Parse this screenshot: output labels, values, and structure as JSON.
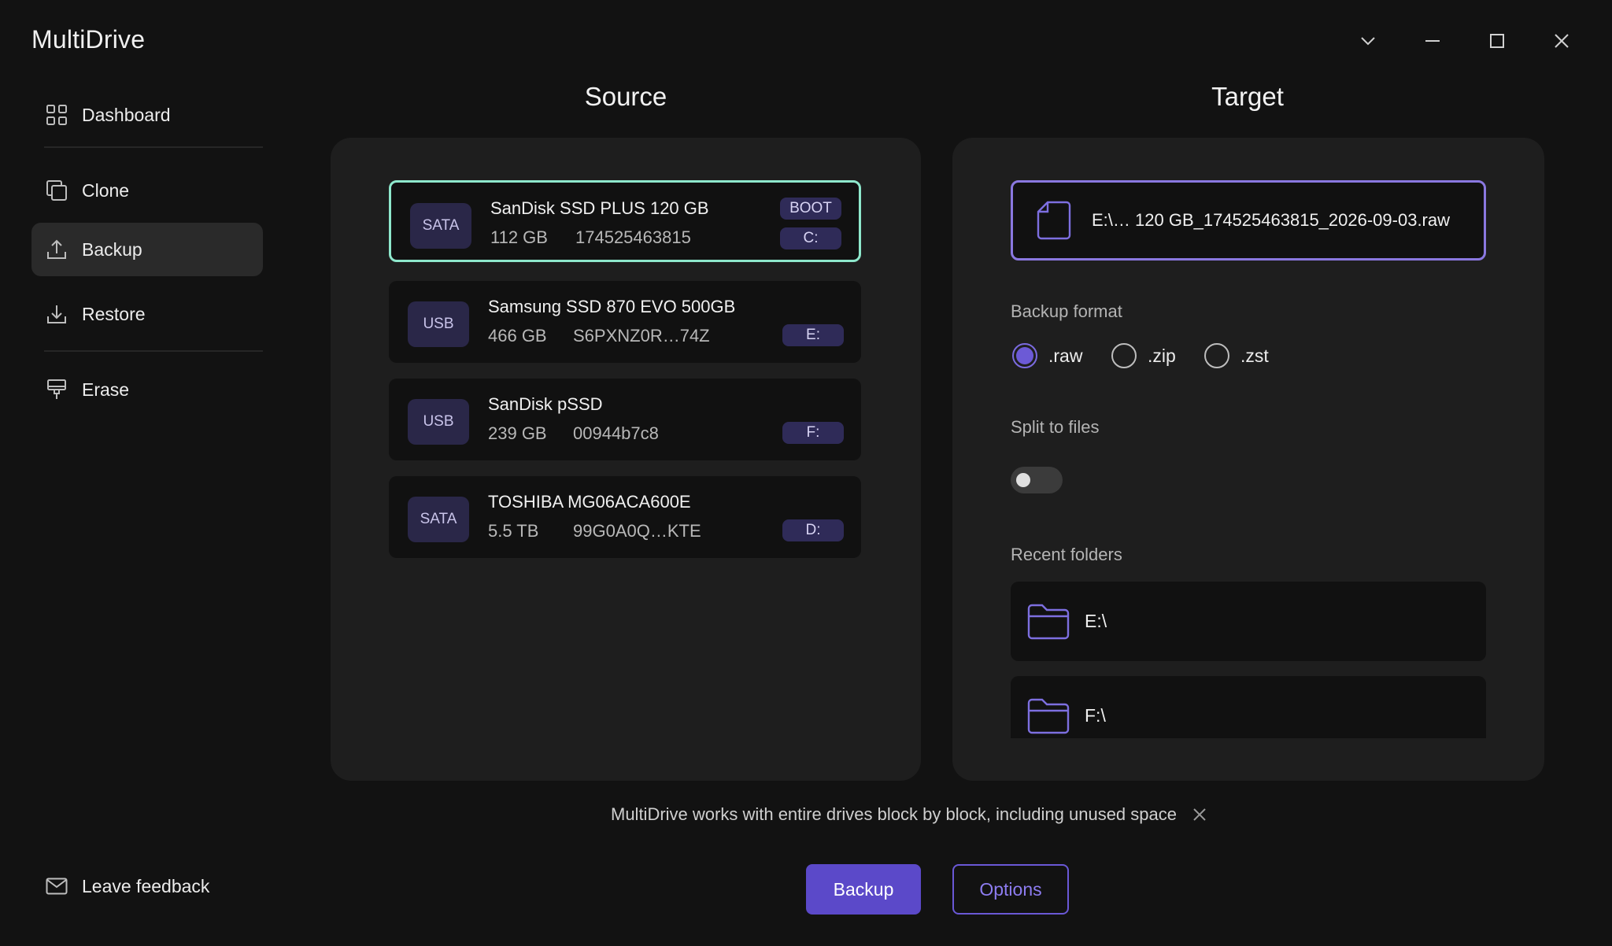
{
  "app": {
    "title": "MultiDrive"
  },
  "window_controls": [
    "chevron-down-icon",
    "minimize-icon",
    "maximize-icon",
    "close-icon"
  ],
  "sidebar": {
    "items": [
      {
        "label": "Dashboard",
        "icon": "dashboard-grid-icon",
        "active": false
      },
      {
        "label": "Clone",
        "icon": "clone-icon",
        "active": false
      },
      {
        "label": "Backup",
        "icon": "upload-icon",
        "active": true
      },
      {
        "label": "Restore",
        "icon": "download-icon",
        "active": false
      },
      {
        "label": "Erase",
        "icon": "brush-icon",
        "active": false
      }
    ],
    "feedback_label": "Leave feedback"
  },
  "source": {
    "title": "Source",
    "drives": [
      {
        "bus": "SATA",
        "name": "SanDisk SSD PLUS 120 GB",
        "size": "112 GB",
        "serial": "174525463815",
        "tags": [
          "BOOT",
          "C:"
        ],
        "selected": true
      },
      {
        "bus": "USB",
        "name": "Samsung SSD 870 EVO 500GB",
        "size": "466 GB",
        "serial": "S6PXNZ0R…74Z",
        "tags": [
          "E:"
        ],
        "selected": false
      },
      {
        "bus": "USB",
        "name": "SanDisk pSSD",
        "size": "239 GB",
        "serial": "00944b7c8",
        "tags": [
          "F:"
        ],
        "selected": false
      },
      {
        "bus": "SATA",
        "name": "TOSHIBA MG06ACA600E",
        "size": "5.5 TB",
        "serial": "99G0A0Q…KTE",
        "tags": [
          "D:"
        ],
        "selected": false
      }
    ]
  },
  "target": {
    "title": "Target",
    "file_path": "E:\\… 120 GB_174525463815_2026-09-03.raw",
    "backup_format_label": "Backup format",
    "formats": [
      {
        "label": ".raw",
        "checked": true
      },
      {
        "label": ".zip",
        "checked": false
      },
      {
        "label": ".zst",
        "checked": false
      }
    ],
    "split_label": "Split to files",
    "split_enabled": false,
    "recent_label": "Recent folders",
    "recent_folders": [
      "E:\\",
      "F:\\"
    ]
  },
  "footer": {
    "info_text": "MultiDrive works with entire drives block by block, including unused space",
    "backup_button": "Backup",
    "options_button": "Options"
  },
  "colors": {
    "accent": "#5b49c9",
    "selected_border": "#8ee8cc",
    "target_border": "#8a78e0",
    "background": "#121212",
    "panel": "#1e1e1e"
  }
}
